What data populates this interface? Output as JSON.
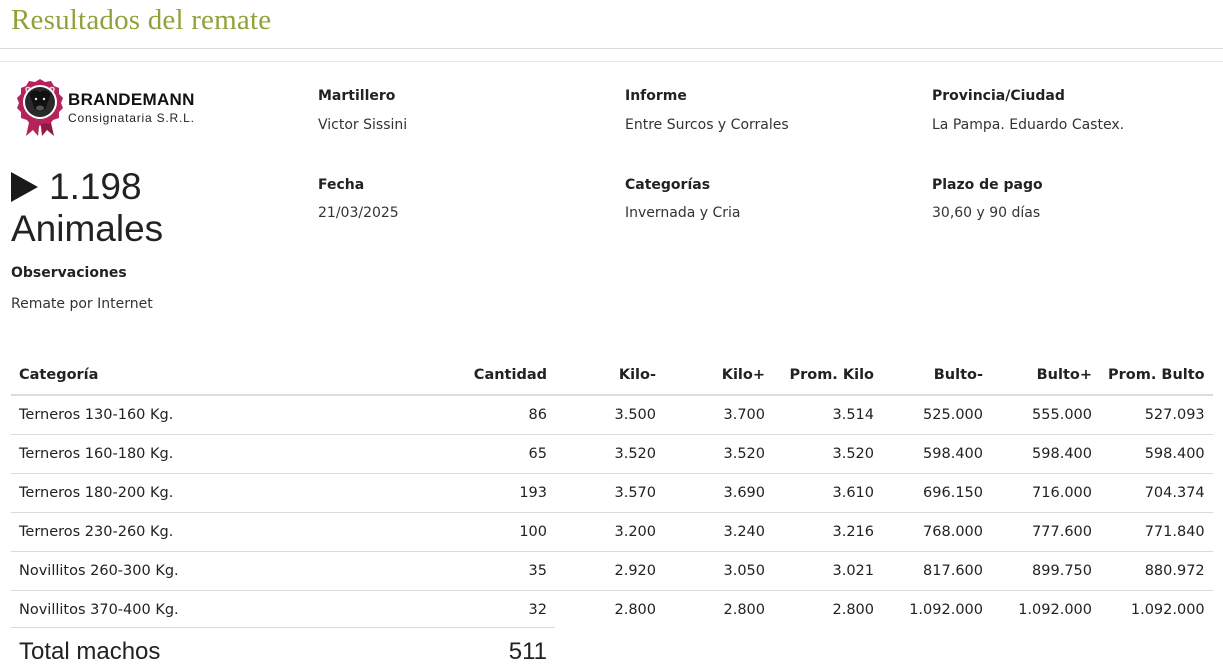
{
  "page": {
    "title": "Resultados del remate"
  },
  "logo": {
    "name": "BRANDEMANN",
    "subtitle": "Consignataria S.R.L.",
    "icon": "bull-head-seal-icon",
    "brand_color": "#b5235a"
  },
  "summary": {
    "count": "1.198",
    "count_label": "Animales",
    "observaciones_label": "Observaciones",
    "observaciones_value": "Remate por Internet"
  },
  "info": {
    "martillero_label": "Martillero",
    "martillero_value": "Victor Sissini",
    "informe_label": "Informe",
    "informe_value": "Entre Surcos y Corrales",
    "provincia_label": "Provincia/Ciudad",
    "provincia_value": "La Pampa. Eduardo Castex.",
    "fecha_label": "Fecha",
    "fecha_value": "21/03/2025",
    "categorias_label": "Categorías",
    "categorias_value": "Invernada y Cria",
    "plazo_label": "Plazo de pago",
    "plazo_value": "30,60 y 90 días"
  },
  "table": {
    "headers": [
      "Categoría",
      "Cantidad",
      "Kilo-",
      "Kilo+",
      "Prom. Kilo",
      "Bulto-",
      "Bulto+",
      "Prom. Bulto"
    ],
    "rows": [
      [
        "Terneros 130-160 Kg.",
        "86",
        "3.500",
        "3.700",
        "3.514",
        "525.000",
        "555.000",
        "527.093"
      ],
      [
        "Terneros 160-180 Kg.",
        "65",
        "3.520",
        "3.520",
        "3.520",
        "598.400",
        "598.400",
        "598.400"
      ],
      [
        "Terneros 180-200 Kg.",
        "193",
        "3.570",
        "3.690",
        "3.610",
        "696.150",
        "716.000",
        "704.374"
      ],
      [
        "Terneros 230-260 Kg.",
        "100",
        "3.200",
        "3.240",
        "3.216",
        "768.000",
        "777.600",
        "771.840"
      ],
      [
        "Novillitos 260-300 Kg.",
        "35",
        "2.920",
        "3.050",
        "3.021",
        "817.600",
        "899.750",
        "880.972"
      ],
      [
        "Novillitos 370-400 Kg.",
        "32",
        "2.800",
        "2.800",
        "2.800",
        "1.092.000",
        "1.092.000",
        "1.092.000"
      ]
    ]
  },
  "total": {
    "label": "Total machos",
    "value": "511"
  },
  "colors": {
    "title": "#8fa33a",
    "text": "#222222",
    "divider": "#dcdcdc"
  }
}
